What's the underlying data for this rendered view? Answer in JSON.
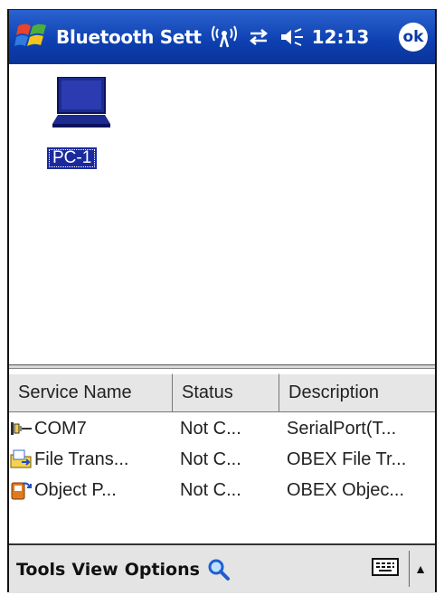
{
  "titlebar": {
    "title": "Bluetooth Sett",
    "time": "12:13",
    "ok_label": "ok",
    "icons": [
      "windows-start-icon",
      "signal-icon",
      "sync-icon",
      "speaker-icon"
    ]
  },
  "device": {
    "label": "PC-1",
    "icon": "laptop-icon"
  },
  "service_list": {
    "headers": [
      "Service Name",
      "Status",
      "Description"
    ],
    "rows": [
      {
        "name": "COM7",
        "status": "Not C...",
        "description": "SerialPort(T...",
        "icon": "serial-port-icon"
      },
      {
        "name": "File Trans...",
        "status": "Not C...",
        "description": "OBEX File Tr...",
        "icon": "file-transfer-icon"
      },
      {
        "name": "Object P...",
        "status": "Not C...",
        "description": "OBEX Objec...",
        "icon": "object-push-icon"
      }
    ]
  },
  "menubar": {
    "items": [
      "Tools",
      "View",
      "Options"
    ],
    "icons": [
      "search-icon",
      "keyboard-icon"
    ],
    "arrow": "▲"
  },
  "colors": {
    "titlebar": "#0d3fb0",
    "selection": "#1a2a9e",
    "menubar": "#e4e4e4"
  }
}
